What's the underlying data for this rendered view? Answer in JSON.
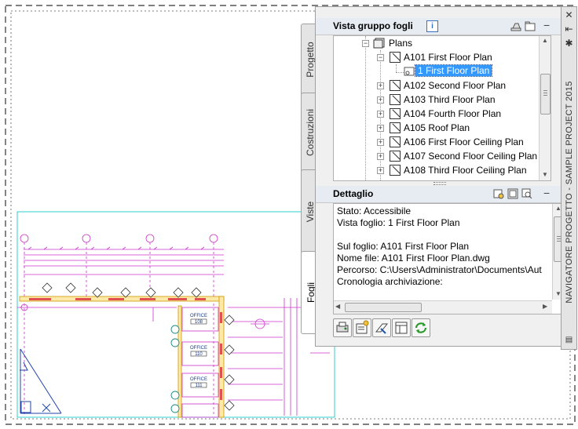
{
  "palette": {
    "title": "NAVIGATORE PROGETTO - SAMPLE PROJECT 2015",
    "tabs": [
      "Progetto",
      "Costruzioni",
      "Viste",
      "Fogli"
    ],
    "active_tab": "Fogli",
    "sheet_set_view": {
      "title": "Vista gruppo fogli",
      "info_glyph": "i",
      "root": "Plans",
      "items": [
        {
          "label": "A101 First Floor Plan",
          "expanded": true
        },
        {
          "label": "1 First Floor Plan",
          "selected": true,
          "child": true
        },
        {
          "label": "A102 Second Floor Plan"
        },
        {
          "label": "A103 Third Floor Plan"
        },
        {
          "label": "A104 Fourth Floor Plan"
        },
        {
          "label": "A105 Roof Plan"
        },
        {
          "label": "A106 First Floor Ceiling Plan"
        },
        {
          "label": "A107 Second Floor Ceiling Plan"
        },
        {
          "label": "A108 Third Floor Ceiling Plan"
        }
      ]
    },
    "detail": {
      "title": "Dettaglio",
      "lines": [
        "Stato: Accessibile",
        "Vista foglio: 1 First Floor Plan",
        "",
        "Sul foglio: A101 First Floor Plan",
        "Nome file: A101 First Floor Plan.dwg",
        "Percorso: C:\\Users\\Administrator\\Documents\\Aut",
        "Cronologia archiviazione:"
      ]
    },
    "toolbar_icons": [
      "plot-icon",
      "new-sheet-icon",
      "publish-icon",
      "properties-icon",
      "refresh-icon"
    ],
    "accent_color": "#3399ff"
  },
  "drawing": {
    "room_labels": [
      "OFFICE",
      "OFFICE",
      "OFFICE"
    ],
    "room_numbers": [
      "108",
      "110",
      "111"
    ],
    "magenta": "#cc33cc",
    "cyan": "#33cccc"
  }
}
